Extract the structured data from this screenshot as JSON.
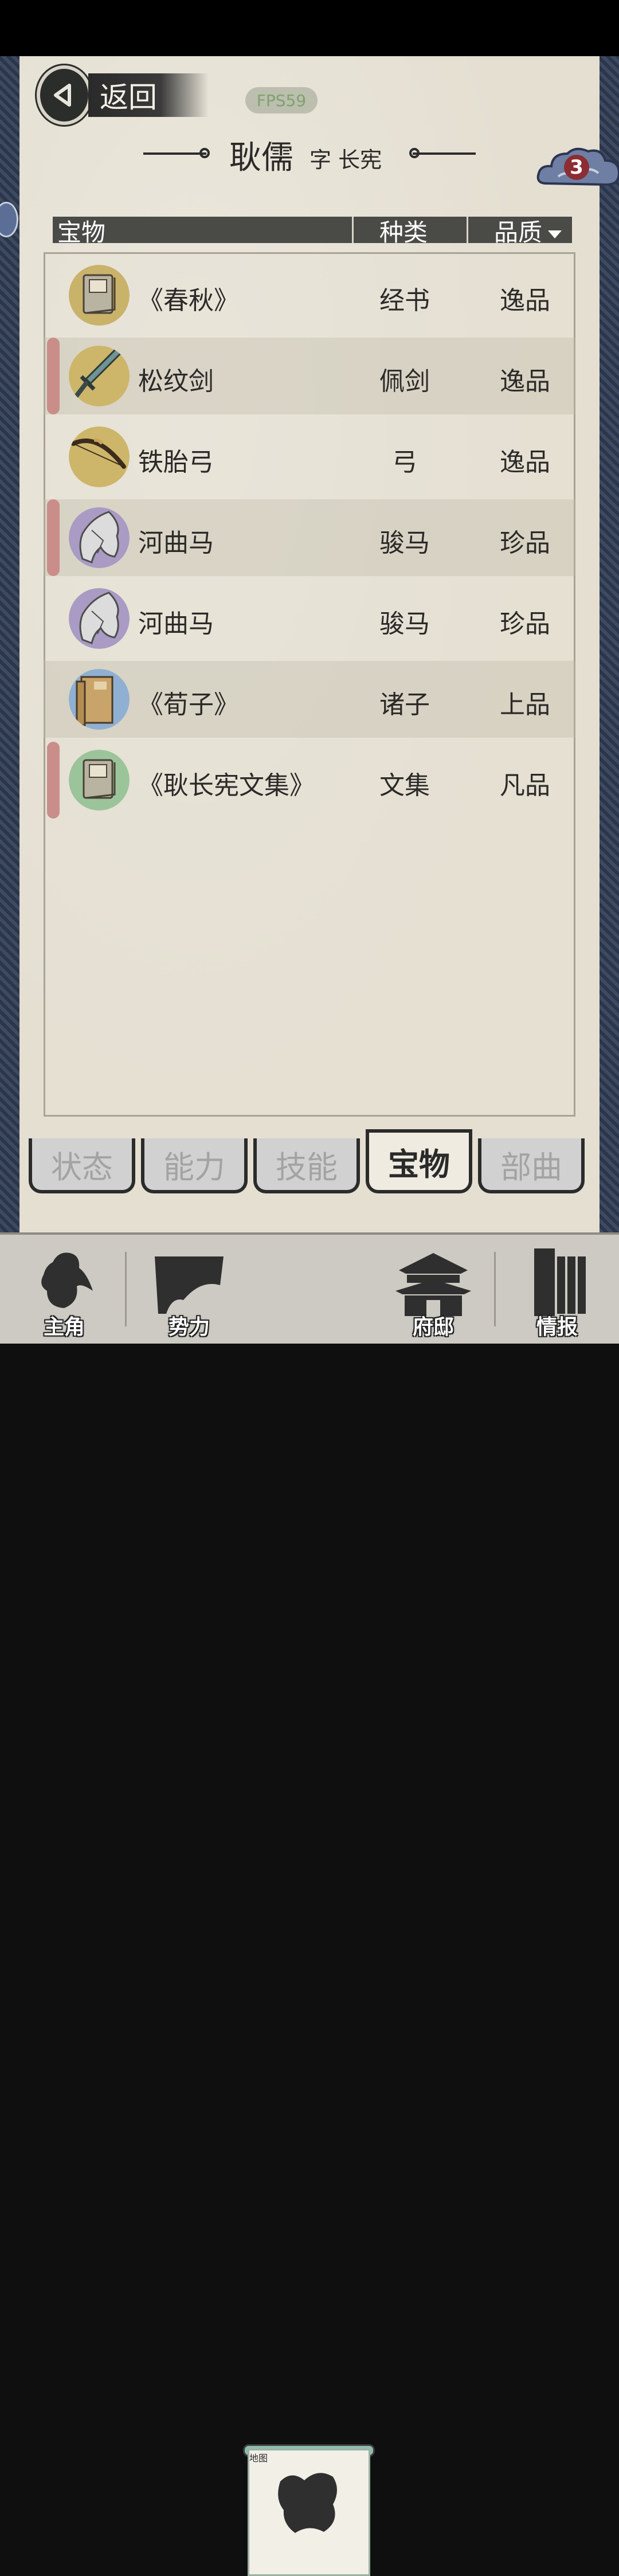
{
  "header": {
    "back_label": "返回",
    "fps": "FPS59",
    "name": "耿儒",
    "style_name": "字 长宪",
    "badge_count": "3"
  },
  "table": {
    "columns": [
      "宝物",
      "种类",
      "品质"
    ],
    "rows": [
      {
        "title": "《春秋》",
        "type": "经书",
        "quality": "逸品",
        "icon": "book-icon",
        "marked": false
      },
      {
        "title": "松纹剑",
        "type": "佩剑",
        "quality": "逸品",
        "icon": "sword-icon",
        "marked": true
      },
      {
        "title": "铁胎弓",
        "type": "弓",
        "quality": "逸品",
        "icon": "bow-icon",
        "marked": false
      },
      {
        "title": "河曲马",
        "type": "骏马",
        "quality": "珍品",
        "icon": "horse-icon",
        "marked": true
      },
      {
        "title": "河曲马",
        "type": "骏马",
        "quality": "珍品",
        "icon": "horse-icon",
        "marked": false
      },
      {
        "title": "《荀子》",
        "type": "诸子",
        "quality": "上品",
        "icon": "book-stack-icon",
        "marked": false
      },
      {
        "title": "《耿长宪文集》",
        "type": "文集",
        "quality": "凡品",
        "icon": "book-icon",
        "marked": true
      }
    ]
  },
  "tabs": [
    "状态",
    "能力",
    "技能",
    "宝物",
    "部曲"
  ],
  "active_tab": "宝物",
  "bottom_nav": [
    {
      "label": "主角",
      "icon": "hero-icon"
    },
    {
      "label": "势力",
      "icon": "flag-icon"
    },
    {
      "label": "地图",
      "icon": "map-icon"
    },
    {
      "label": "府邸",
      "icon": "mansion-icon"
    },
    {
      "label": "情报",
      "icon": "scroll-icon"
    }
  ],
  "colors": {
    "paper": "#e4dfd1",
    "header_bar": "#4a4a47",
    "marker": "#c98e89",
    "fps_text": "#7ea36c",
    "badge": "#8b2d32"
  }
}
